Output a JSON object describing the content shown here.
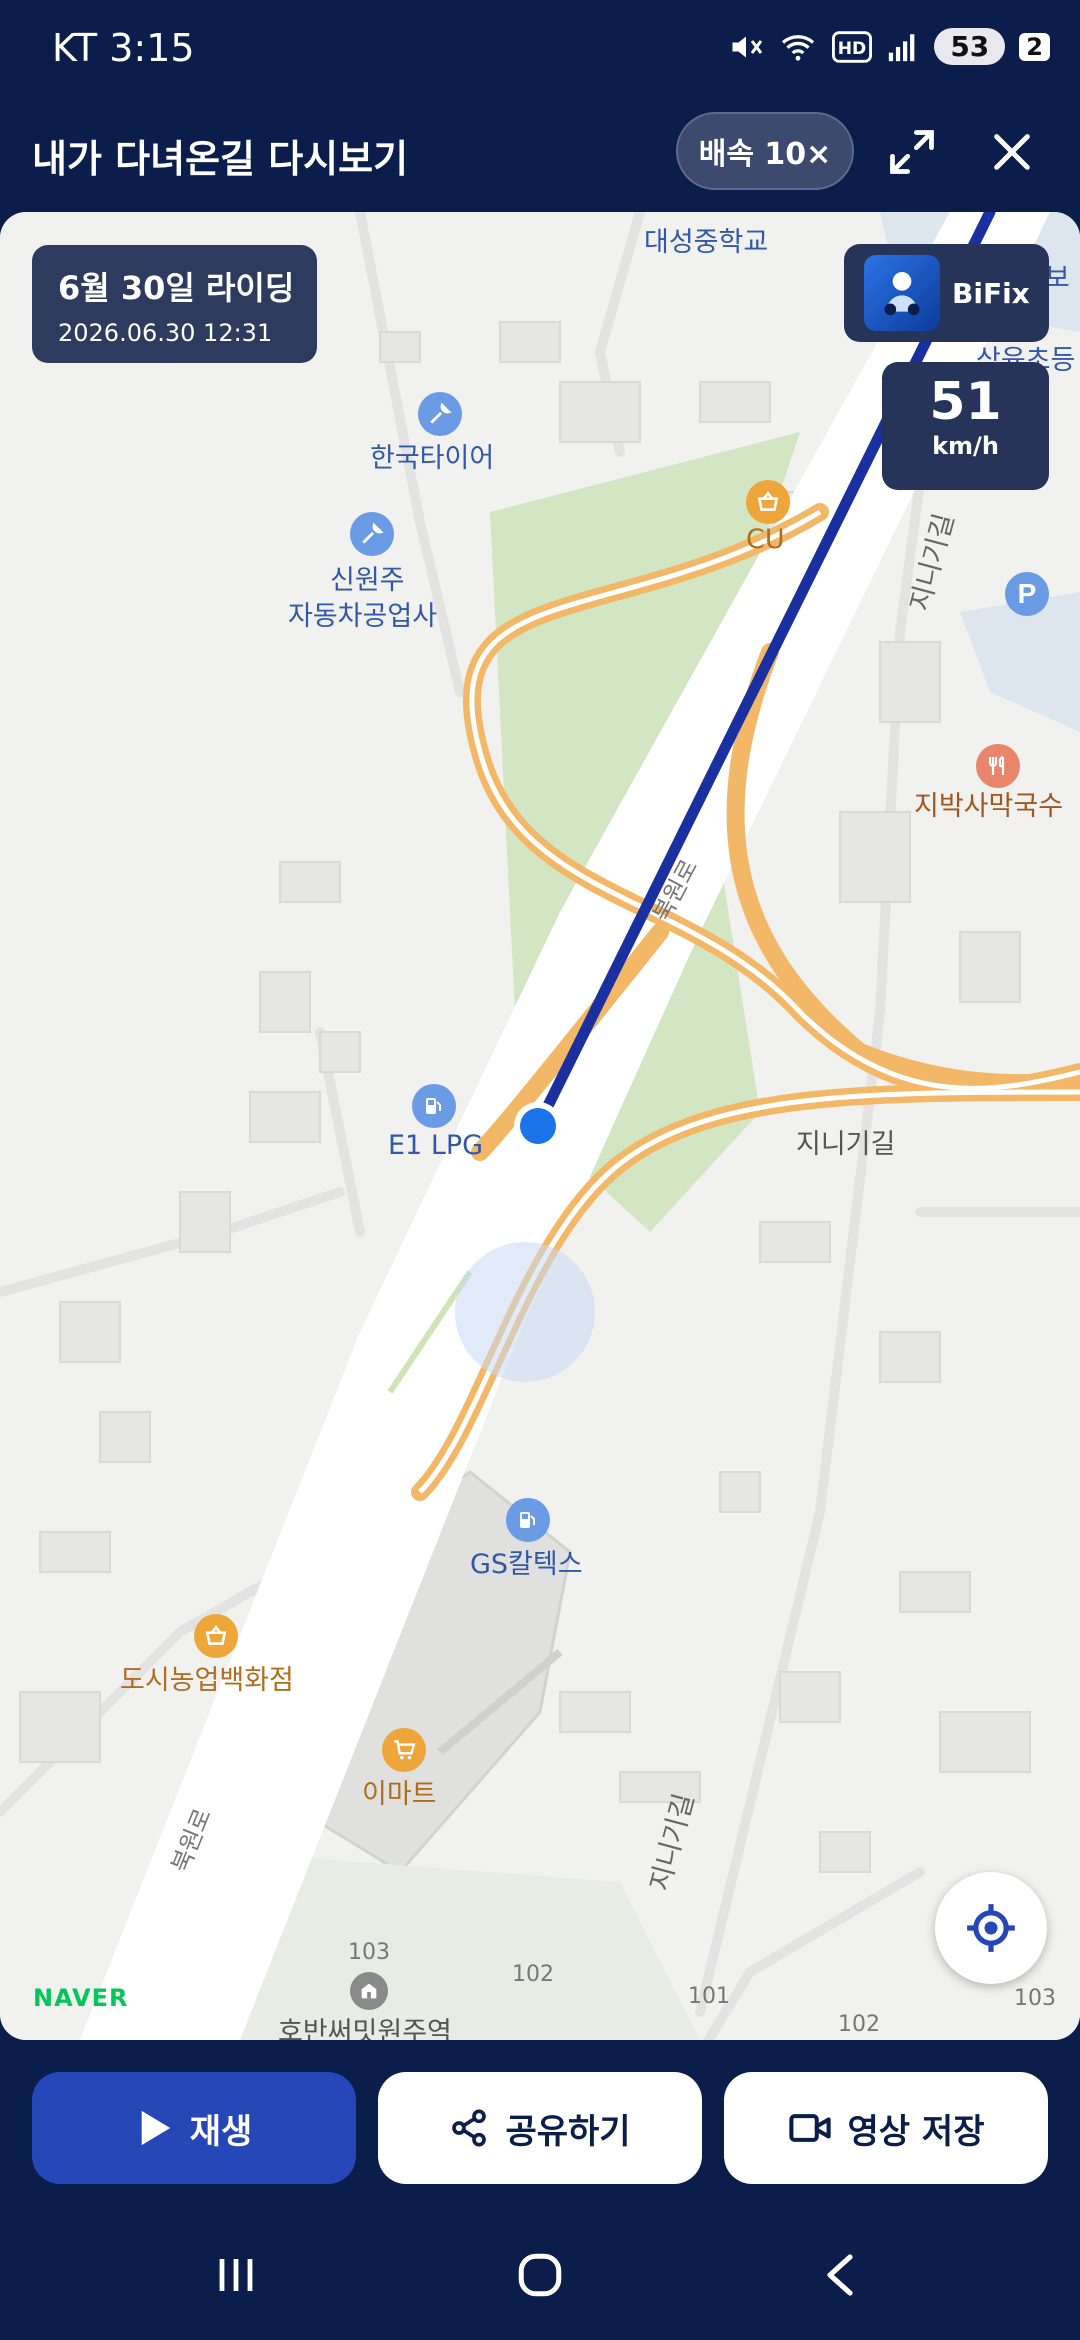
{
  "status_bar": {
    "carrier_time": "KT 3:15",
    "battery": "53",
    "sim": "2",
    "icons": [
      "mute-icon",
      "wifi-icon",
      "hd-icon",
      "signal-icon"
    ]
  },
  "header": {
    "title": "내가 다녀온길 다시보기",
    "speed_button": "배속 10×",
    "icons": [
      "fullscreen-icon",
      "close-icon"
    ]
  },
  "overlay": {
    "ride_title": "6월 30일 라이딩",
    "ride_datetime": "2026.06.30 12:31",
    "brand_label": "BiFix",
    "speed_value": "51",
    "speed_unit": "km/h"
  },
  "map": {
    "labels": {
      "school": "대성중학교",
      "dolbo": "돌보",
      "samyuk": "삼육초등",
      "hankook": "한국타이어",
      "cu": "CU",
      "shinwonju_1": "신원주",
      "shinwonju_2": "자동차공업사",
      "jibaksa": "지박사막국수",
      "e1": "E1 LPG",
      "jinigi_1": "지니기길",
      "jinigi_2": "지니기길",
      "jinigi_3": "지니기길",
      "bukwon_1": "북원로",
      "bukwon_2": "북원로",
      "gs": "GS칼텍스",
      "dosi": "도시농업백화점",
      "emart": "이마트",
      "apt": "호반써밋원주역",
      "bldg_103a": "103",
      "bldg_102a": "102",
      "bldg_101": "101",
      "bldg_102b": "102",
      "bldg_103b": "103"
    },
    "provider": "NAVER",
    "accent_route": "#1a2fa0",
    "road_orange": "#f3b867",
    "green_area": "#d3e6c3"
  },
  "actions": {
    "play": "재생",
    "share": "공유하기",
    "save_video": "영상 저장"
  },
  "nav": {
    "icons": [
      "recent-apps-icon",
      "home-icon",
      "back-icon"
    ]
  }
}
